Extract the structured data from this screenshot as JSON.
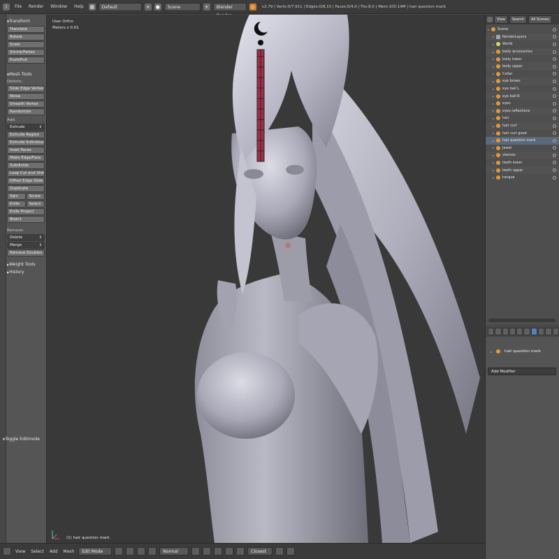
{
  "header": {
    "menus": [
      "File",
      "Render",
      "Window",
      "Help"
    ],
    "layout": "Default",
    "scene": "Scene",
    "engine": "Blender Render",
    "stats": "v2.79 | Verts:0/7,911 | Edges:0/8,15 | Faces:0/4,0 | Tris:8,0 | Mem:100.14M | hair question mark"
  },
  "toolshelf": {
    "transform_header": "Transform",
    "transform_buttons": [
      "Translate",
      "Rotate",
      "Scale",
      "Shrink/Fatten",
      "Push/Pull"
    ],
    "mesh_tools_header": "Mesh Tools",
    "deform_label": "Deform:",
    "deform_buttons": [
      "Slide Edge  Vertex",
      "Noise",
      "Smooth Vertex",
      "Randomize"
    ],
    "add_label": "Add:",
    "add_dropdown": "Extrude",
    "add_buttons": [
      "Extrude Region",
      "Extrude Individual",
      "Inset Faces",
      "Make Edge/Face",
      "Subdivide",
      "Loop Cut and Slide",
      "Offset Edge Slide",
      "Duplicate"
    ],
    "pair1": [
      "Spin",
      "Screw"
    ],
    "pair2": [
      "Knife",
      "Select"
    ],
    "more_buttons": [
      "Knife Project",
      "Bisect"
    ],
    "remove_label": "Remove:",
    "remove_dropdowns": [
      "Delete",
      "Merge"
    ],
    "remove_doubles": "Remove Doubles",
    "weight_tools": "Weight Tools",
    "history": "History",
    "toggle_editmode": "Toggle Editmode"
  },
  "viewport": {
    "view_name": "User Ortho",
    "units": "Meters x 0.01",
    "object_label": "(1) hair question mark"
  },
  "footer": {
    "menus": [
      "View",
      "Select",
      "Add",
      "Mesh"
    ],
    "mode": "Edit Mode",
    "pivot": "Normal",
    "snap": "Closest"
  },
  "outliner": {
    "tabs": [
      "View",
      "Search",
      "All Scenes"
    ],
    "items": [
      {
        "label": "Scene",
        "icon": "scene",
        "indent": 0
      },
      {
        "label": "RenderLayers",
        "icon": "cam",
        "indent": 1
      },
      {
        "label": "World",
        "icon": "lamp",
        "indent": 1
      },
      {
        "label": "body accessories",
        "icon": "mesh",
        "indent": 1
      },
      {
        "label": "body lower",
        "icon": "mesh",
        "indent": 1
      },
      {
        "label": "body upper",
        "icon": "mesh",
        "indent": 1
      },
      {
        "label": "Collar",
        "icon": "mesh",
        "indent": 1
      },
      {
        "label": "eye brows",
        "icon": "mesh",
        "indent": 1
      },
      {
        "label": "eye ball L",
        "icon": "mesh",
        "indent": 1
      },
      {
        "label": "eye ball R",
        "icon": "mesh",
        "indent": 1
      },
      {
        "label": "eyes",
        "icon": "mesh",
        "indent": 1
      },
      {
        "label": "eyes reflections",
        "icon": "mesh",
        "indent": 1
      },
      {
        "label": "hair",
        "icon": "mesh",
        "indent": 1
      },
      {
        "label": "hair curl",
        "icon": "mesh",
        "indent": 1
      },
      {
        "label": "hair curl good",
        "icon": "mesh",
        "indent": 1
      },
      {
        "label": "hair question mark",
        "icon": "mesh",
        "indent": 1,
        "selected": true
      },
      {
        "label": "Jewel",
        "icon": "mesh",
        "indent": 1
      },
      {
        "label": "sleeves",
        "icon": "mesh",
        "indent": 1
      },
      {
        "label": "teeth lower",
        "icon": "mesh",
        "indent": 1
      },
      {
        "label": "teeth upper",
        "icon": "mesh",
        "indent": 1
      },
      {
        "label": "tongue",
        "icon": "mesh",
        "indent": 1
      }
    ]
  },
  "properties": {
    "object_name": "hair question mark",
    "add_modifier": "Add Modifier"
  },
  "colors": {
    "viewport_bg": "#393939",
    "mesh_color": "#c8c8d6",
    "jewel_color": "#a0304a",
    "selected_row": "#5b6a7b"
  }
}
